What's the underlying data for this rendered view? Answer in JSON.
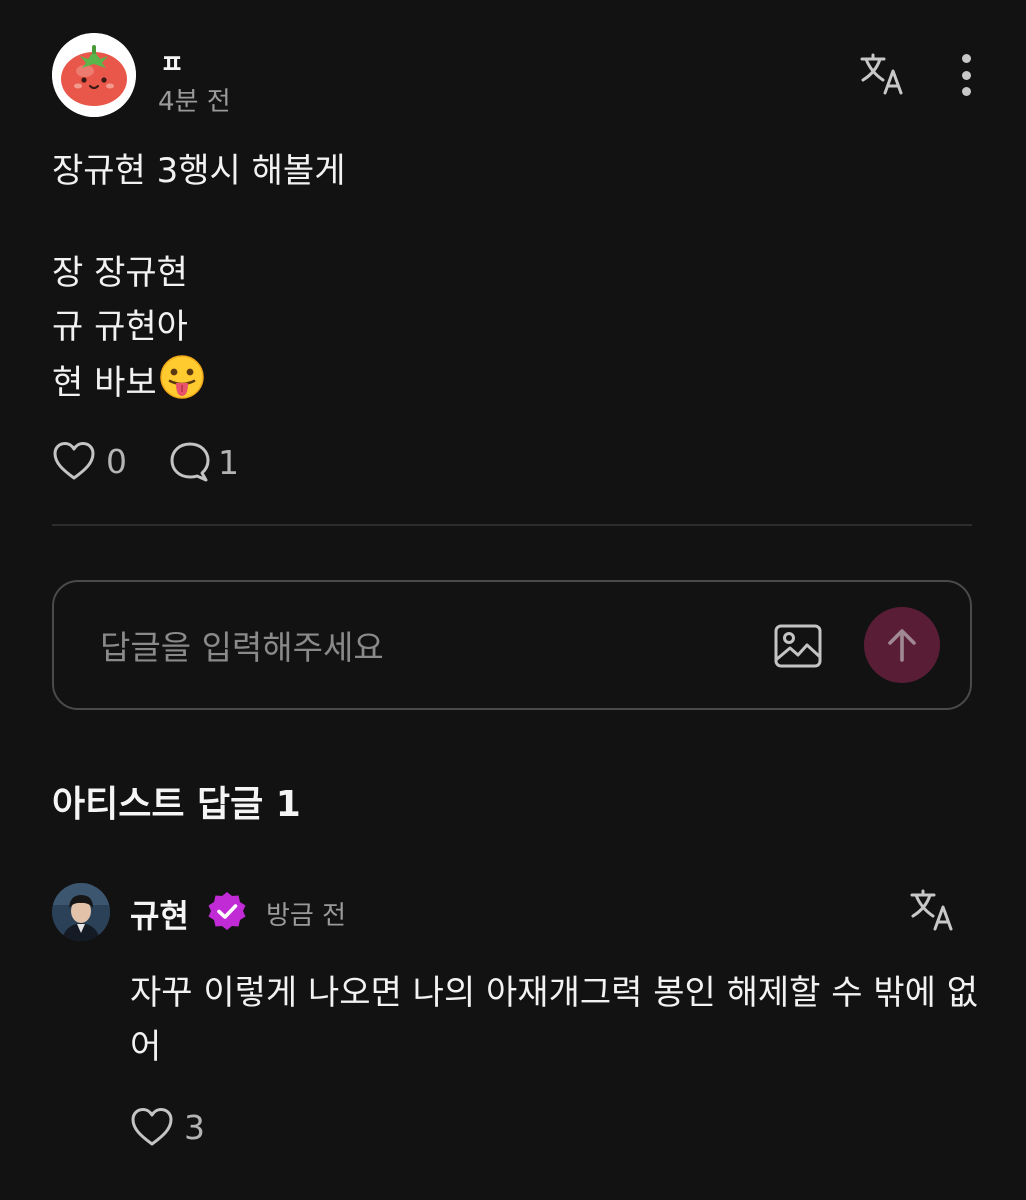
{
  "post": {
    "author": "ㅍ",
    "time": "4분 전",
    "lines": [
      "장규현 3행시 해볼게",
      "장 장규현",
      "규 규현아",
      "현 바보"
    ],
    "likes": "0",
    "comments": "1",
    "icons": {
      "avatar": "tomato-avatar",
      "translate": "translate-icon",
      "more": "more-vertical-icon",
      "emoji": "tongue-out-emoji",
      "like": "heart-icon",
      "comment": "comment-bubble-icon"
    }
  },
  "reply_input": {
    "placeholder": "답글을 입력해주세요",
    "icons": {
      "image": "image-icon",
      "send": "arrow-up-icon"
    }
  },
  "artist_replies": {
    "title": "아티스트 답글 1",
    "items": [
      {
        "name": "규현",
        "time": "방금 전",
        "text": "자꾸 이렇게 나오면 나의 아재개그력 봉인 해제할 수 밖에 없어",
        "likes": "3"
      }
    ]
  },
  "colors": {
    "background": "#121212",
    "send_button": "#5a1d36",
    "verified_badge": "#c02bd6",
    "muted_text": "#9a9a9a"
  }
}
